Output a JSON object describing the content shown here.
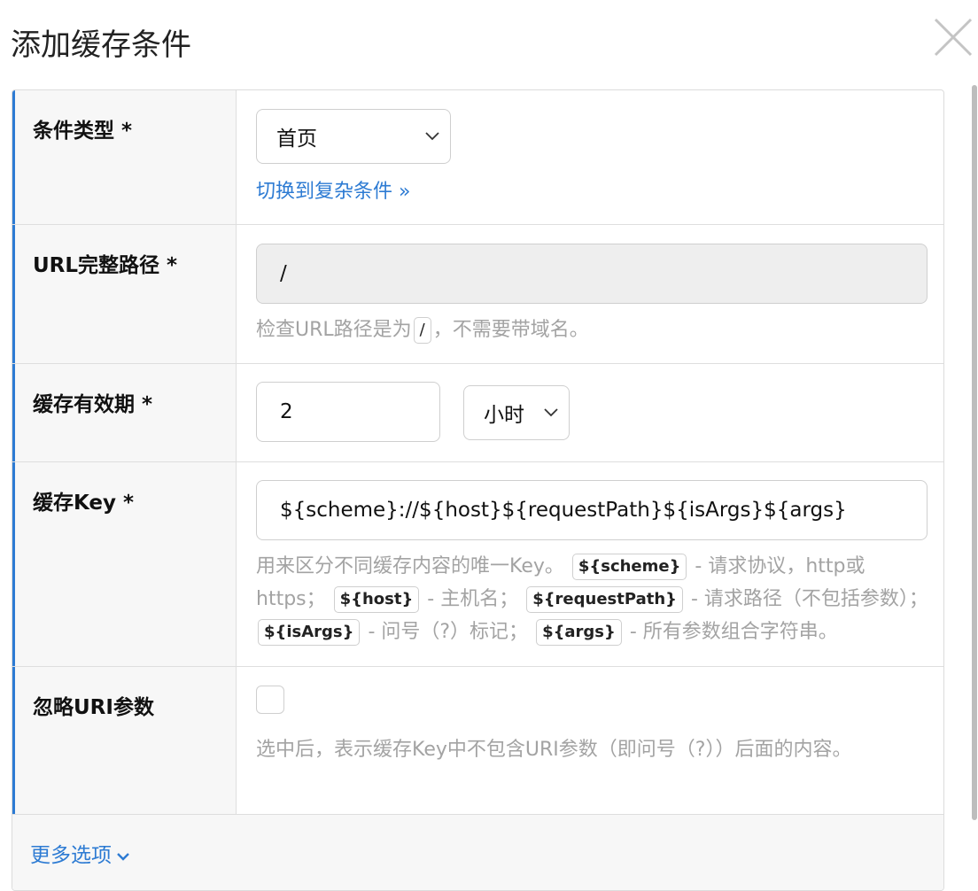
{
  "dialog": {
    "title": "添加缓存条件",
    "close_icon": "close-icon"
  },
  "rows": {
    "condition_type": {
      "label": "条件类型 *",
      "select_value": "首页",
      "switch_link": "切换到复杂条件 »"
    },
    "url_path": {
      "label": "URL完整路径 *",
      "value": "/",
      "help_before": "检查URL路径是为",
      "help_code": "/",
      "help_after": "，不需要带域名。"
    },
    "expire": {
      "label": "缓存有效期 *",
      "value": "2",
      "unit": "小时"
    },
    "cache_key": {
      "label": "缓存Key *",
      "value": "${scheme}://${host}${requestPath}${isArgs}${args}",
      "help": {
        "t1": "用来区分不同缓存内容的唯一Key。",
        "c1": "${scheme}",
        "t2": " - 请求协议，http或https；",
        "c2": "${host}",
        "t3": " - 主机名；",
        "c3": "${requestPath}",
        "t4": " - 请求路径（不包括参数）；",
        "c4": "${isArgs}",
        "t5": " - 问号（?）标记；",
        "c5": "${args}",
        "t6": " - 所有参数组合字符串。"
      }
    },
    "ignore_uri_args": {
      "label": "忽略URI参数",
      "checked": false,
      "help": "选中后，表示缓存Key中不包含URI参数（即问号（?））后面的内容。"
    }
  },
  "footer": {
    "more_options": "更多选项"
  },
  "colors": {
    "accent": "#2d7bd3",
    "label_bg": "#f7f7f7",
    "help_text": "#a3a3a3"
  }
}
